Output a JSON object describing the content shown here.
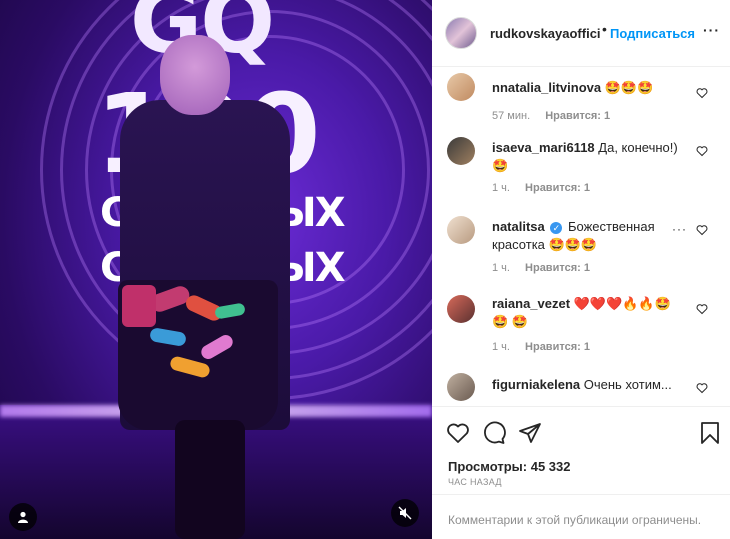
{
  "media": {
    "brand_gq": "GQ",
    "brand_num": "100",
    "brand_line1": "СТИЛЬНЫХ",
    "brand_line2": "СТИЛЬНЫХ",
    "user_icon": "user-icon",
    "mute_icon": "speaker-muted-icon"
  },
  "header": {
    "username": "rudkovskayaofficial",
    "separator": "•",
    "follow_label": "Подписаться",
    "more_label": "···"
  },
  "comments": [
    {
      "user": "nnatalia_litvinova",
      "text": "🤩🤩🤩",
      "time": "57 мин.",
      "likes": "Нравится: 1",
      "verified": false
    },
    {
      "user": "isaeva_mari6118",
      "text": "Да, конечно!) 🤩",
      "time": "1 ч.",
      "likes": "Нравится: 1",
      "verified": false
    },
    {
      "user": "natalitsa",
      "text": "Божественная красотка 🤩🤩🤩",
      "time": "1 ч.",
      "likes": "Нравится: 1",
      "verified": true,
      "more": "···"
    },
    {
      "user": "raiana_vezet",
      "text": "❤️❤️❤️🔥🔥🤩🤩 🤩",
      "time": "1 ч.",
      "likes": "Нравится: 1",
      "verified": false
    },
    {
      "user": "figurniakelena",
      "text": "Очень хотим...",
      "time": "",
      "likes": "",
      "verified": false
    }
  ],
  "actions": {
    "views_label": "Просмотры:",
    "views_count": "45 332",
    "time_ago": "ЧАС НАЗАД",
    "comments_limited": "Комментарии к этой публикации ограничены."
  },
  "colors": {
    "link_blue": "#0095f6",
    "muted_text": "#8e8e8e",
    "text": "#262626",
    "verified": "#3897f0"
  }
}
